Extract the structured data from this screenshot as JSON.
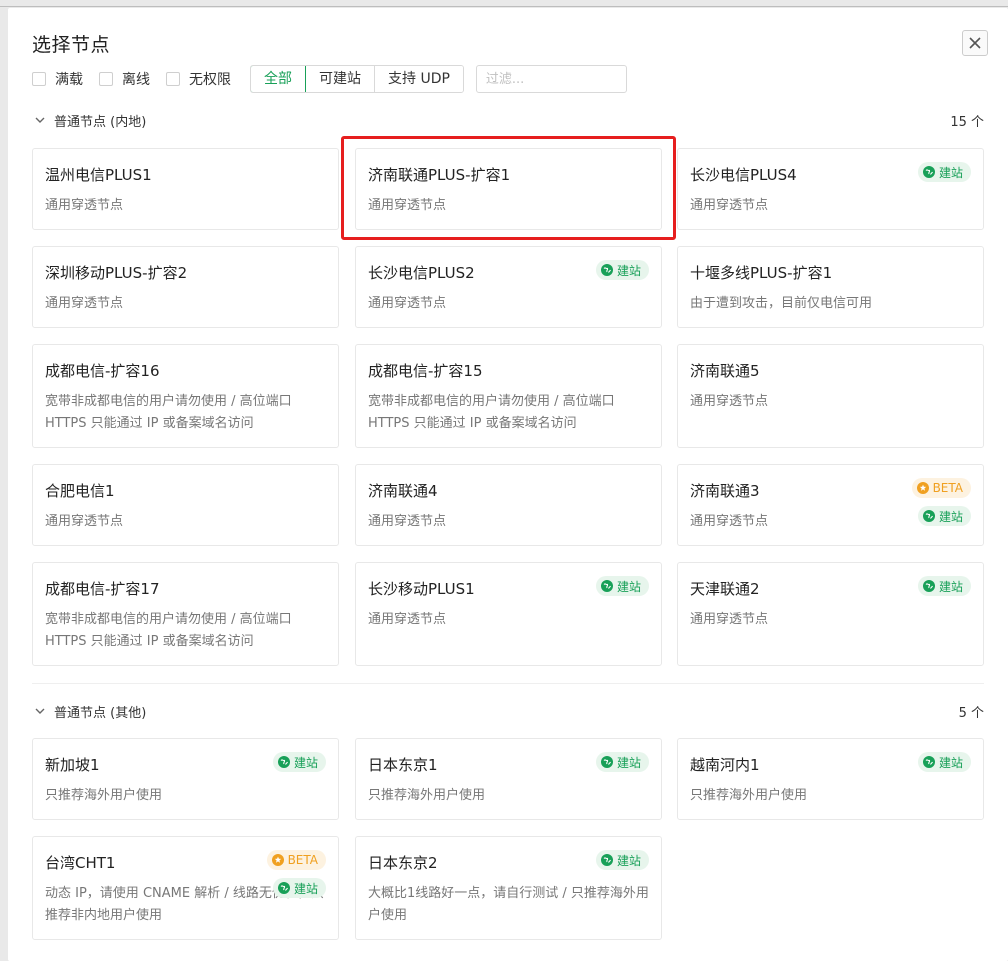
{
  "dialog": {
    "title": "选择节点",
    "close_icon": "close-icon"
  },
  "filters": {
    "checkboxes": [
      "满载",
      "离线",
      "无权限"
    ],
    "segments": [
      "全部",
      "可建站",
      "支持 UDP"
    ],
    "active_segment": "全部",
    "search_placeholder": "过滤...",
    "search_value": ""
  },
  "tags": {
    "site": "建站",
    "beta": "BETA"
  },
  "groups": [
    {
      "title": "普通节点 (内地)",
      "count": "15 个",
      "nodes": [
        {
          "name": "温州电信PLUS1",
          "desc": "通用穿透节点",
          "tags": []
        },
        {
          "name": "济南联通PLUS-扩容1",
          "desc": "通用穿透节点",
          "tags": [],
          "highlighted": true
        },
        {
          "name": "长沙电信PLUS4",
          "desc": "通用穿透节点",
          "tags": [
            "site"
          ]
        },
        {
          "name": "深圳移动PLUS-扩容2",
          "desc": "通用穿透节点",
          "tags": []
        },
        {
          "name": "长沙电信PLUS2",
          "desc": "通用穿透节点",
          "tags": [
            "site"
          ]
        },
        {
          "name": "十堰多线PLUS-扩容1",
          "desc": "由于遭到攻击，目前仅电信可用",
          "tags": []
        },
        {
          "name": "成都电信-扩容16",
          "desc": "宽带非成都电信的用户请勿使用 / 高位端口 HTTPS 只能通过 IP 或备案域名访问",
          "tags": []
        },
        {
          "name": "成都电信-扩容15",
          "desc": "宽带非成都电信的用户请勿使用 / 高位端口 HTTPS 只能通过 IP 或备案域名访问",
          "tags": []
        },
        {
          "name": "济南联通5",
          "desc": "通用穿透节点",
          "tags": []
        },
        {
          "name": "合肥电信1",
          "desc": "通用穿透节点",
          "tags": []
        },
        {
          "name": "济南联通4",
          "desc": "通用穿透节点",
          "tags": []
        },
        {
          "name": "济南联通3",
          "desc": "通用穿透节点",
          "tags": [
            "beta",
            "site"
          ]
        },
        {
          "name": "成都电信-扩容17",
          "desc": "宽带非成都电信的用户请勿使用 / 高位端口 HTTPS 只能通过 IP 或备案域名访问",
          "tags": []
        },
        {
          "name": "长沙移动PLUS1",
          "desc": "通用穿透节点",
          "tags": [
            "site"
          ]
        },
        {
          "name": "天津联通2",
          "desc": "通用穿透节点",
          "tags": [
            "site"
          ]
        }
      ]
    },
    {
      "title": "普通节点 (其他)",
      "count": "5 个",
      "nodes": [
        {
          "name": "新加坡1",
          "desc": "只推荐海外用户使用",
          "tags": [
            "site"
          ]
        },
        {
          "name": "日本东京1",
          "desc": "只推荐海外用户使用",
          "tags": [
            "site"
          ]
        },
        {
          "name": "越南河内1",
          "desc": "只推荐海外用户使用",
          "tags": [
            "site"
          ]
        },
        {
          "name": "台湾CHT1",
          "desc": "动态 IP，请使用 CNAME 解析 / 线路无优化，只推荐非内地用户使用",
          "tags": [
            "beta",
            "site"
          ]
        },
        {
          "name": "日本东京2",
          "desc": "大概比1线路好一点，请自行测试 / 只推荐海外用户使用",
          "tags": [
            "site"
          ]
        }
      ]
    }
  ]
}
